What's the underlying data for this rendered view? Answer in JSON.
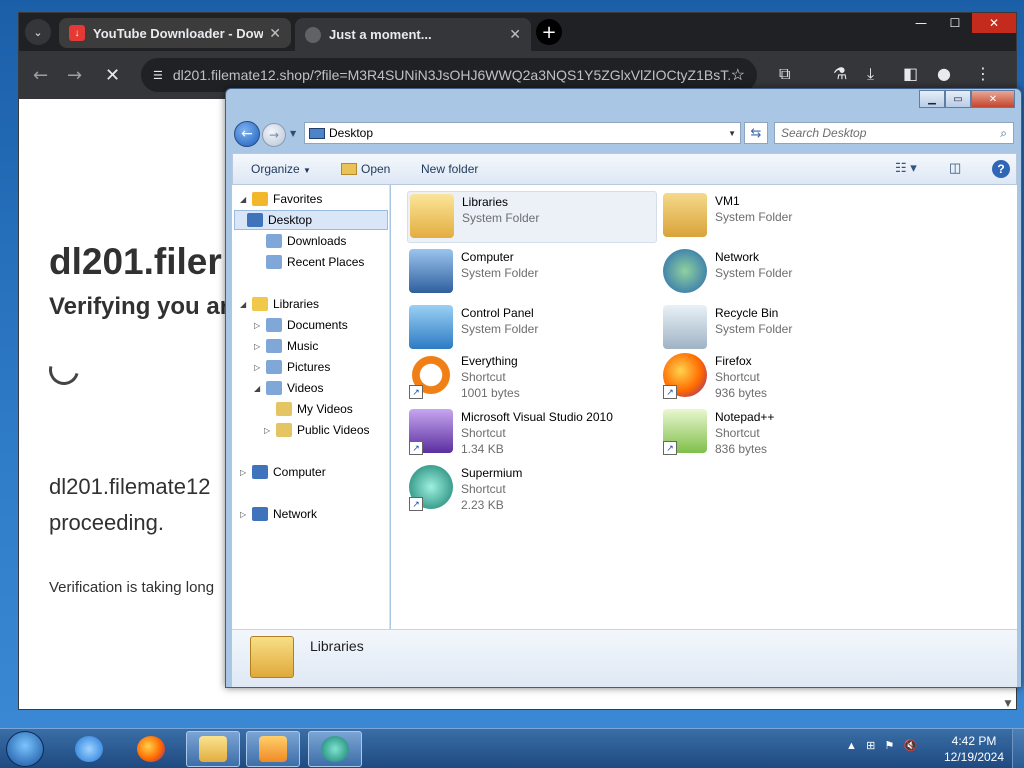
{
  "browser": {
    "tabs": [
      {
        "title": "YouTube Downloader - Download",
        "close": "✕"
      },
      {
        "title": "Just a moment...",
        "close": "✕"
      }
    ],
    "new_tab": "+",
    "window_controls": {
      "minimize": "—",
      "maximize": "☐",
      "close": "✕"
    },
    "url": "dl201.filemate12.shop/?file=M3R4SUNiN3JsOHJ6WWQ2a3NQS1Y5ZGlxVlZIOCtyZ1BsT...",
    "page": {
      "heading": "dl201.filer",
      "subheading": "Verifying you are",
      "paragraph_line1": "dl201.filemate12",
      "paragraph_line2": "proceeding.",
      "small": "Verification is taking long"
    }
  },
  "explorer": {
    "address": "Desktop",
    "search_placeholder": "Search Desktop",
    "commands": {
      "organize": "Organize",
      "open": "Open",
      "new_folder": "New folder"
    },
    "nav": [
      {
        "label": "Favorites",
        "indent": 0,
        "arrow": "◢"
      },
      {
        "label": "Desktop",
        "indent": 1,
        "arrow": "",
        "selected": true
      },
      {
        "label": "Downloads",
        "indent": 1,
        "arrow": ""
      },
      {
        "label": "Recent Places",
        "indent": 1,
        "arrow": ""
      },
      {
        "label": "Libraries",
        "indent": 0,
        "arrow": "◢"
      },
      {
        "label": "Documents",
        "indent": 1,
        "arrow": "▷"
      },
      {
        "label": "Music",
        "indent": 1,
        "arrow": "▷"
      },
      {
        "label": "Pictures",
        "indent": 1,
        "arrow": "▷"
      },
      {
        "label": "Videos",
        "indent": 1,
        "arrow": "◢"
      },
      {
        "label": "My Videos",
        "indent": 2,
        "arrow": ""
      },
      {
        "label": "Public Videos",
        "indent": 2,
        "arrow": "▷"
      },
      {
        "label": "Computer",
        "indent": 0,
        "arrow": "▷"
      },
      {
        "label": "Network",
        "indent": 0,
        "arrow": "▷"
      }
    ],
    "items": [
      {
        "name": "Libraries",
        "type": "System Folder",
        "size": "",
        "icon": "libraries-icon"
      },
      {
        "name": "VM1",
        "type": "System Folder",
        "size": "",
        "icon": "user-folder-icon"
      },
      {
        "name": "Computer",
        "type": "System Folder",
        "size": "",
        "icon": "computer-icon"
      },
      {
        "name": "Network",
        "type": "System Folder",
        "size": "",
        "icon": "network-icon"
      },
      {
        "name": "Control Panel",
        "type": "System Folder",
        "size": "",
        "icon": "control-panel-icon"
      },
      {
        "name": "Recycle Bin",
        "type": "System Folder",
        "size": "",
        "icon": "recycle-bin-icon"
      },
      {
        "name": "Everything",
        "type": "Shortcut",
        "size": "1001 bytes",
        "icon": "everything-icon"
      },
      {
        "name": "Firefox",
        "type": "Shortcut",
        "size": "936 bytes",
        "icon": "firefox-icon"
      },
      {
        "name": "Microsoft Visual Studio 2010",
        "type": "Shortcut",
        "size": "1.34 KB",
        "icon": "visual-studio-icon"
      },
      {
        "name": "Notepad++",
        "type": "Shortcut",
        "size": "836 bytes",
        "icon": "notepadpp-icon"
      },
      {
        "name": "Supermium",
        "type": "Shortcut",
        "size": "2.23 KB",
        "icon": "supermium-icon"
      }
    ],
    "details_label": "Libraries"
  },
  "taskbar": {
    "time": "4:42 PM",
    "date": "12/19/2024"
  }
}
